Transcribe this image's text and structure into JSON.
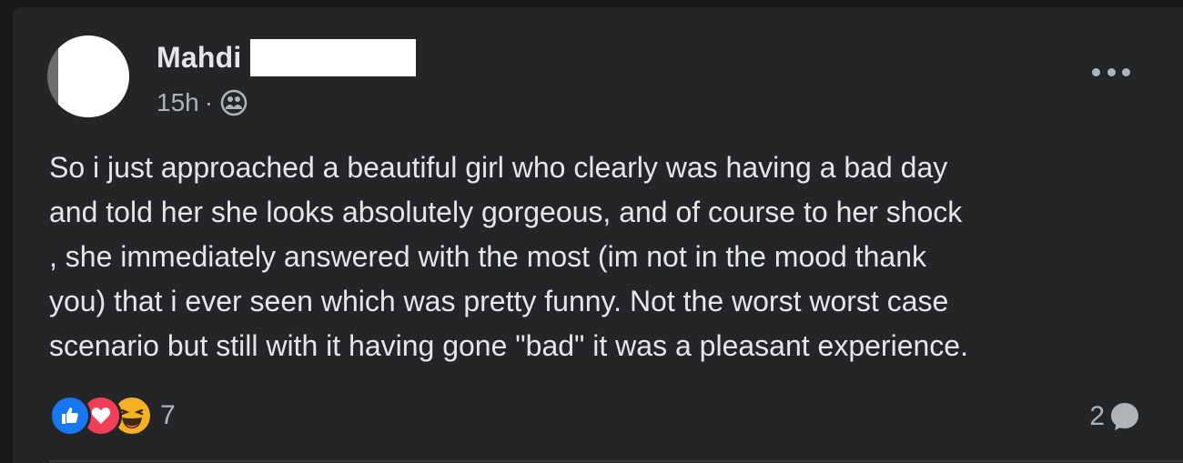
{
  "post": {
    "author_name": "Mahdi",
    "timestamp": "15h",
    "separator": "·",
    "audience_icon": "friends-icon",
    "body": "So i just approached a beautiful girl who clearly was having a bad day\nand told her she looks absolutely gorgeous, and of course to her shock\n, she immediately answered with the most (im not in the mood thank\nyou) that i ever seen which was pretty funny. Not the worst worst case\nscenario but still with it having gone \"bad\" it was a pleasant experience.",
    "reaction_count": "7",
    "comment_count": "2",
    "reactions": [
      "like",
      "love",
      "haha"
    ]
  },
  "colors": {
    "page_background": "#18191a",
    "card_background": "#242526",
    "primary_text": "#e4e6eb",
    "secondary_text": "#b0b3b8",
    "like_blue": "#1877f2",
    "love_red": "#f33e58",
    "haha_yellow": "#f7b125"
  }
}
